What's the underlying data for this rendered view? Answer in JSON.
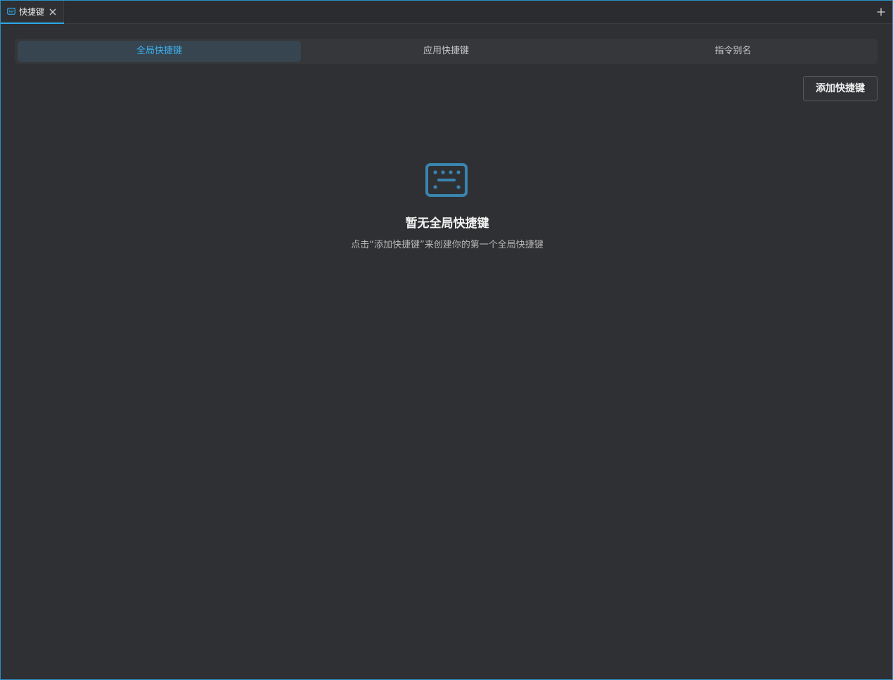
{
  "tab": {
    "label": "快捷键",
    "icon": "keyboard-icon",
    "close_icon": "close-icon"
  },
  "tabbar": {
    "add_icon": "plus-icon"
  },
  "segments": [
    {
      "label": "全局快捷键",
      "active": true
    },
    {
      "label": "应用快捷键",
      "active": false
    },
    {
      "label": "指令别名",
      "active": false
    }
  ],
  "toolbar": {
    "add_label": "添加快捷键"
  },
  "empty_state": {
    "icon": "keyboard-icon",
    "title": "暂无全局快捷键",
    "description": "点击“添加快捷键”来创建你的第一个全局快捷键"
  },
  "colors": {
    "accent": "#2ea8e6",
    "active_text": "#3fb0ee",
    "icon": "#3a84b0",
    "background": "#2f3033"
  }
}
